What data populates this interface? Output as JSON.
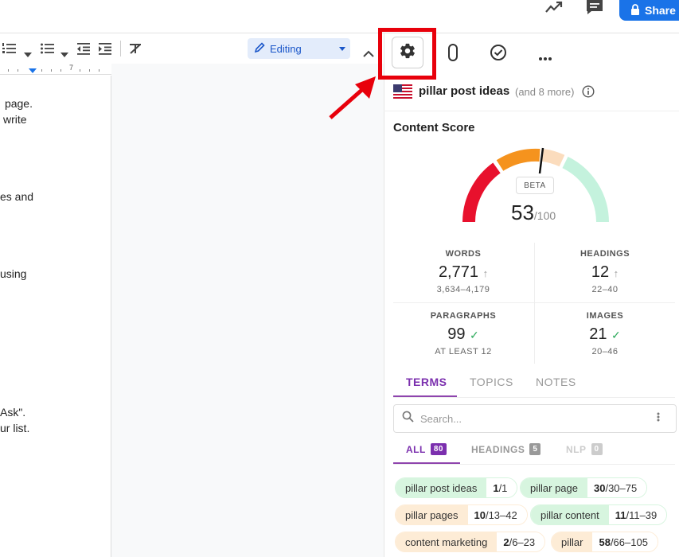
{
  "header": {
    "share_label": "Share"
  },
  "toolbar": {
    "mode_label": "Editing"
  },
  "ruler": {
    "mark": "7"
  },
  "doc": {
    "lines": [
      "page.",
      "write",
      "es and",
      "using",
      "Ask\".",
      "ur list."
    ]
  },
  "panel": {
    "keyword": "pillar post ideas",
    "keyword_more": "(and 8 more)",
    "score_title": "Content Score",
    "score_badge": "BETA",
    "score_value": "53",
    "score_max": "/100",
    "score_gauge_value": 53,
    "stats": [
      {
        "label": "WORDS",
        "value": "2,771",
        "range": "3,634–4,179",
        "status": "up"
      },
      {
        "label": "HEADINGS",
        "value": "12",
        "range": "22–40",
        "status": "up"
      },
      {
        "label": "PARAGRAPHS",
        "value": "99",
        "range": "AT LEAST 12",
        "status": "check"
      },
      {
        "label": "IMAGES",
        "value": "21",
        "range": "20–46",
        "status": "check"
      }
    ],
    "tabs": [
      "TERMS",
      "TOPICS",
      "NOTES"
    ],
    "search_placeholder": "Search...",
    "subtabs": [
      {
        "label": "ALL",
        "count": "80"
      },
      {
        "label": "HEADINGS",
        "count": "5"
      },
      {
        "label": "NLP",
        "count": "0"
      }
    ],
    "terms": [
      {
        "term": "pillar post ideas",
        "current": "1",
        "target": "/1",
        "color": "green"
      },
      {
        "term": "pillar page",
        "current": "30",
        "target": "/30–75",
        "color": "green"
      },
      {
        "term": "pillar pages",
        "current": "10",
        "target": "/13–42",
        "color": "orange"
      },
      {
        "term": "pillar content",
        "current": "11",
        "target": "/11–39",
        "color": "green"
      },
      {
        "term": "content marketing",
        "current": "2",
        "target": "/6–23",
        "color": "orange"
      },
      {
        "term": "pillar",
        "current": "58",
        "target": "/66–105",
        "color": "orange"
      }
    ]
  },
  "colors": {
    "accent": "#7b2fae",
    "share_blue": "#1a73e8",
    "highlight_red": "#e8000b",
    "gauge_red": "#e8112d",
    "gauge_orange": "#f5931e",
    "gauge_peach": "#fbdcbd",
    "gauge_mint": "#c4f2dd"
  }
}
